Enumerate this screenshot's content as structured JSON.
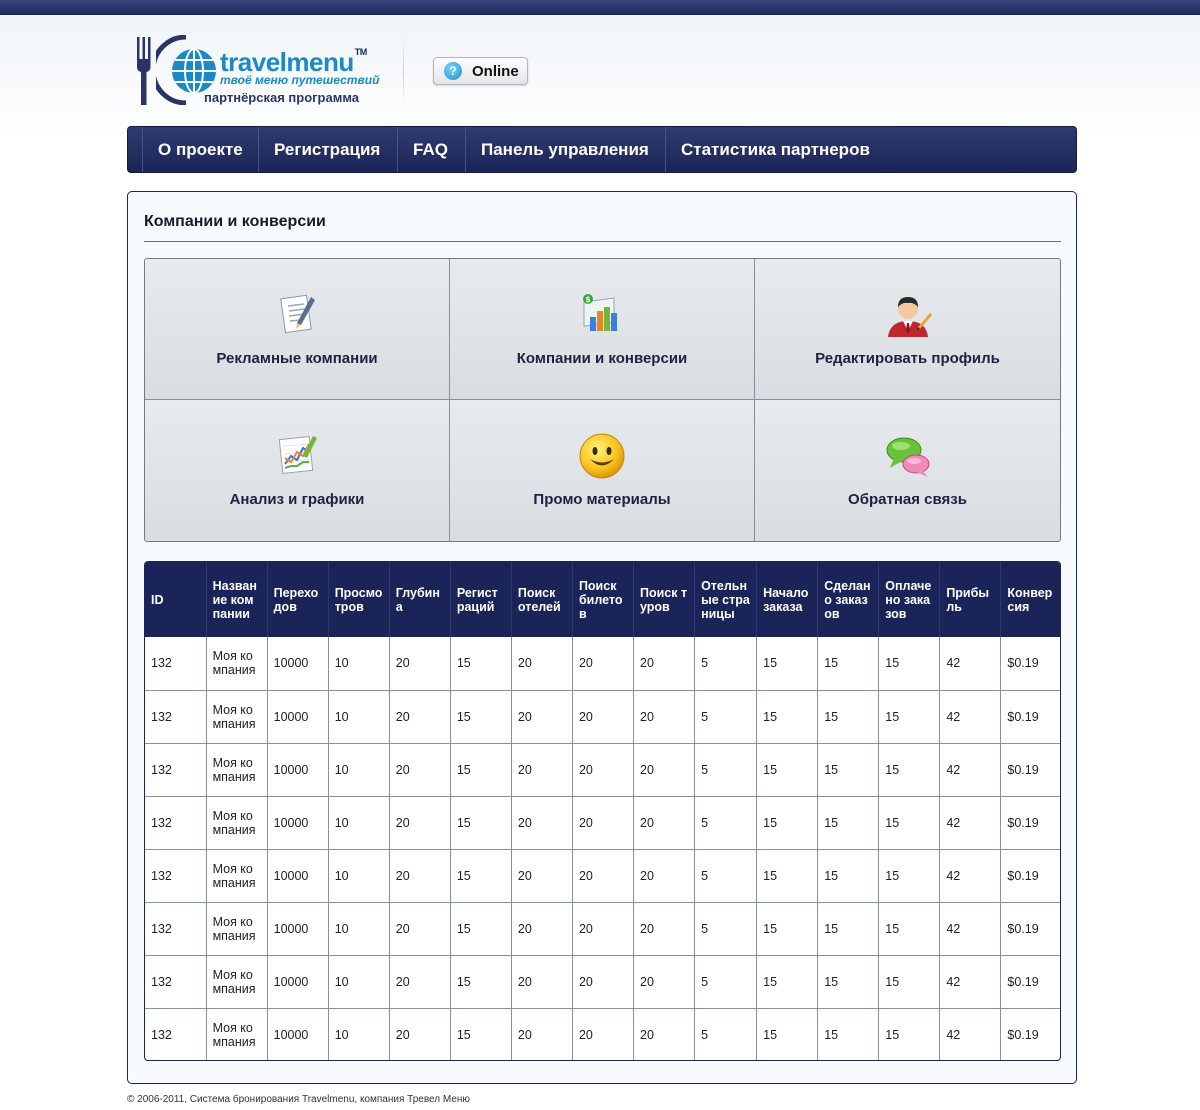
{
  "header": {
    "brand": "travelmenu",
    "trademark": "TM",
    "tagline": "твоё меню путешествий",
    "partner_label": "партнёрская программа",
    "online_button": {
      "icon": "help-icon",
      "glyph": "?",
      "label": "Online"
    }
  },
  "nav": {
    "items": [
      {
        "label": "О проекте"
      },
      {
        "label": "Регистрация"
      },
      {
        "label": "FAQ"
      },
      {
        "label": "Панель управления"
      },
      {
        "label": "Статистика партнеров"
      }
    ]
  },
  "main": {
    "title": "Компании и конверсии",
    "tiles": [
      {
        "label": "Рекламные компании",
        "icon": "document-edit-icon"
      },
      {
        "label": "Компании и конверсии",
        "icon": "bar-chart-money-icon"
      },
      {
        "label": "Редактировать профиль",
        "icon": "user-edit-icon"
      },
      {
        "label": "Анализ и графики",
        "icon": "line-chart-icon"
      },
      {
        "label": "Промо материалы",
        "icon": "smiley-icon"
      },
      {
        "label": "Обратная связь",
        "icon": "speech-bubbles-icon"
      }
    ],
    "table": {
      "columns": [
        "ID",
        "Название компании",
        "Переходов",
        "Просмотров",
        "Глубина",
        "Регистраций",
        "Поиск отелей",
        "Поиск билетов",
        "Поиск туров",
        "Отельные страницы",
        "Начало заказа",
        "Сделано заказов",
        "Оплачено заказов",
        "Прибыль",
        "Конверсия"
      ],
      "rows": [
        [
          "132",
          "Моя компания",
          "10000",
          "10",
          "20",
          "15",
          "20",
          "20",
          "20",
          "5",
          "15",
          "15",
          "15",
          "42",
          "$0.19"
        ],
        [
          "132",
          "Моя компания",
          "10000",
          "10",
          "20",
          "15",
          "20",
          "20",
          "20",
          "5",
          "15",
          "15",
          "15",
          "42",
          "$0.19"
        ],
        [
          "132",
          "Моя компания",
          "10000",
          "10",
          "20",
          "15",
          "20",
          "20",
          "20",
          "5",
          "15",
          "15",
          "15",
          "42",
          "$0.19"
        ],
        [
          "132",
          "Моя компания",
          "10000",
          "10",
          "20",
          "15",
          "20",
          "20",
          "20",
          "5",
          "15",
          "15",
          "15",
          "42",
          "$0.19"
        ],
        [
          "132",
          "Моя компания",
          "10000",
          "10",
          "20",
          "15",
          "20",
          "20",
          "20",
          "5",
          "15",
          "15",
          "15",
          "42",
          "$0.19"
        ],
        [
          "132",
          "Моя компания",
          "10000",
          "10",
          "20",
          "15",
          "20",
          "20",
          "20",
          "5",
          "15",
          "15",
          "15",
          "42",
          "$0.19"
        ],
        [
          "132",
          "Моя компания",
          "10000",
          "10",
          "20",
          "15",
          "20",
          "20",
          "20",
          "5",
          "15",
          "15",
          "15",
          "42",
          "$0.19"
        ],
        [
          "132",
          "Моя компания",
          "10000",
          "10",
          "20",
          "15",
          "20",
          "20",
          "20",
          "5",
          "15",
          "15",
          "15",
          "42",
          "$0.19"
        ]
      ]
    }
  },
  "footer": {
    "text": "© 2006-2011, Система бронирования Travelmenu, компания Тревел Меню"
  },
  "colors": {
    "brand_blue": "#1b88c8",
    "navy": "#1c2557",
    "panel_bg": "#f7fbfd",
    "tile_bg": "#dde2e6"
  }
}
